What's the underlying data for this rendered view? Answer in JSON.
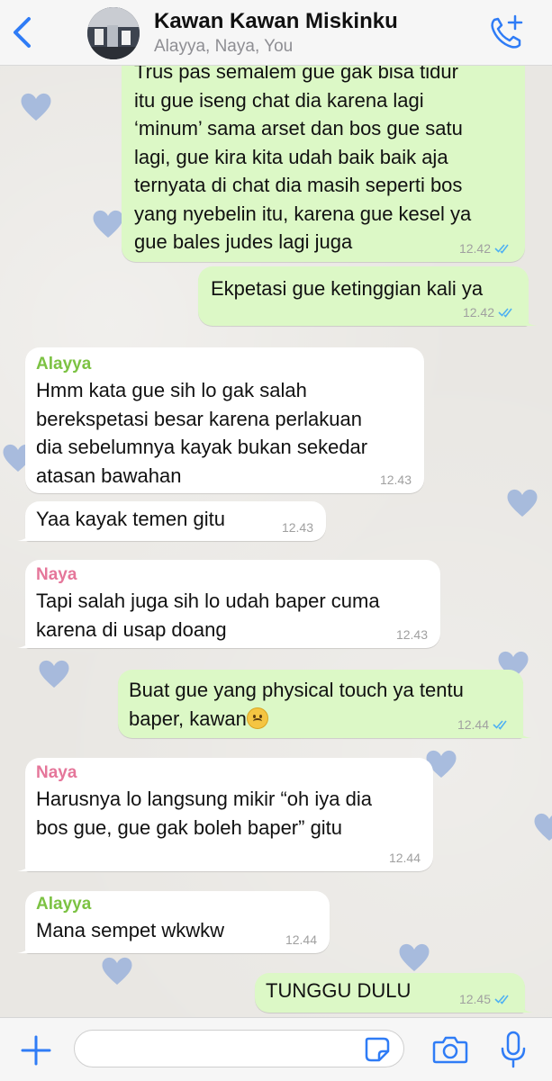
{
  "header": {
    "title": "Kawan Kawan Miskinku",
    "subtitle": "Alayya, Naya, You"
  },
  "messages": [
    {
      "direction": "out",
      "text": "Trus pas semalem gue gak bisa tidur\nitu gue iseng chat dia karena lagi\n‘minum’ sama arset dan bos gue satu\nlagi, gue kira kita udah baik baik aja\nternyata di chat dia masih seperti bos\nyang nyebelin itu, karena gue kesel ya\ngue bales judes lagi juga",
      "time": "12.42",
      "read": true
    },
    {
      "direction": "out",
      "text": "Ekpetasi gue ketinggian kali ya",
      "time": "12.42",
      "read": true
    },
    {
      "direction": "in",
      "sender": "Alayya",
      "sender_color": "#7cc243",
      "text": "Hmm kata gue sih lo gak salah\nberekspetasi besar karena perlakuan\ndia sebelumnya kayak bukan sekedar\natasan bawahan",
      "time": "12.43"
    },
    {
      "direction": "in",
      "text": "Yaa kayak temen gitu",
      "time": "12.43"
    },
    {
      "direction": "in",
      "sender": "Naya",
      "sender_color": "#e5769a",
      "text": "Tapi salah juga sih lo udah baper cuma\nkarena di usap doang",
      "time": "12.43"
    },
    {
      "direction": "out",
      "text": "Buat gue yang physical touch ya tentu\nbaper, kawan",
      "emoji": "frowning-face",
      "time": "12.44",
      "read": true
    },
    {
      "direction": "in",
      "sender": "Naya",
      "sender_color": "#e5769a",
      "text": "Harusnya lo langsung mikir “oh iya dia\nbos gue, gue gak boleh baper” gitu",
      "time": "12.44"
    },
    {
      "direction": "in",
      "sender": "Alayya",
      "sender_color": "#7cc243",
      "text": "Mana sempet wkwkw",
      "time": "12.44"
    },
    {
      "direction": "out",
      "text": "TUNGGU DULU",
      "time": "12.45",
      "read": true
    }
  ],
  "input": {
    "value": "",
    "placeholder": ""
  },
  "colors": {
    "accent": "#2f7cf6",
    "outgoing_bubble": "#dcf8c6",
    "incoming_bubble": "#ffffff",
    "read_tick": "#4fb1f2",
    "heart": "#8aa6d8"
  }
}
